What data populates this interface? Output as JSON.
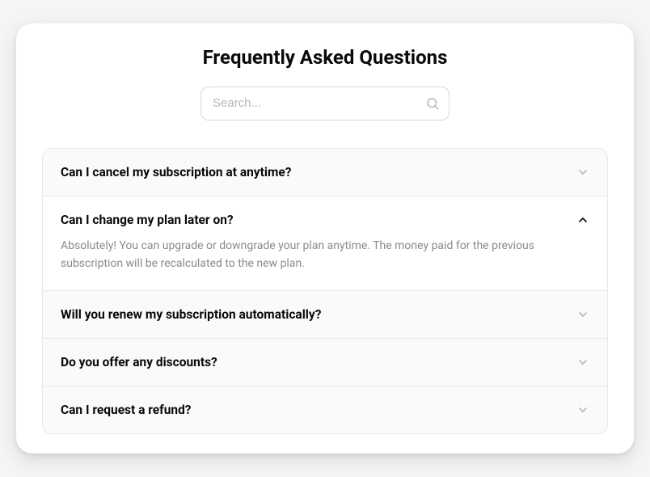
{
  "header": {
    "title": "Frequently Asked Questions"
  },
  "search": {
    "placeholder": "Search...",
    "value": ""
  },
  "faq": {
    "items": [
      {
        "question": "Can I cancel my subscription at anytime?",
        "expanded": false
      },
      {
        "question": "Can I change my plan later on?",
        "answer": "Absolutely! You can upgrade or downgrade your plan anytime. The money paid for the previous subscription will be recalculated to the new plan.",
        "expanded": true
      },
      {
        "question": "Will you renew my subscription automatically?",
        "expanded": false
      },
      {
        "question": "Do you offer any discounts?",
        "expanded": false
      },
      {
        "question": "Can I request a refund?",
        "expanded": false
      }
    ]
  }
}
